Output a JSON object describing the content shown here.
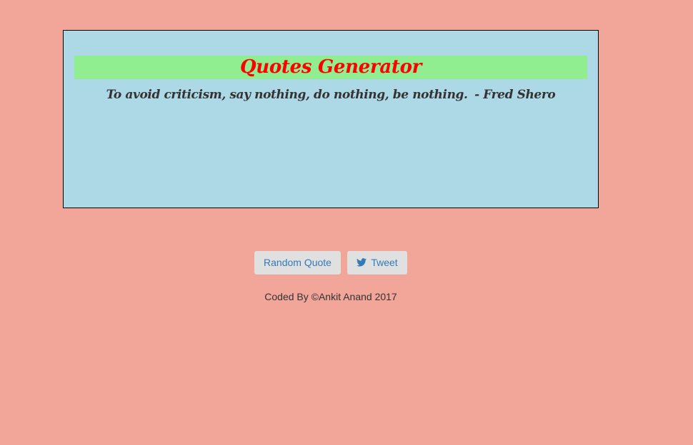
{
  "header": {
    "title": "Quotes Generator"
  },
  "quote": {
    "text": "To avoid criticism, say nothing, do nothing, be nothing.",
    "author": "- Fred Shero"
  },
  "buttons": {
    "random_label": "Random Quote",
    "tweet_label": "Tweet",
    "tweet_icon": "twitter-icon"
  },
  "footer": {
    "text": "Coded By ©Ankit Anand 2017"
  },
  "colors": {
    "page_background": "#f2a599",
    "box_background": "#add8e6",
    "title_bar": "#90ee90",
    "title_text": "#ff0000",
    "button_text": "#337ab7"
  }
}
